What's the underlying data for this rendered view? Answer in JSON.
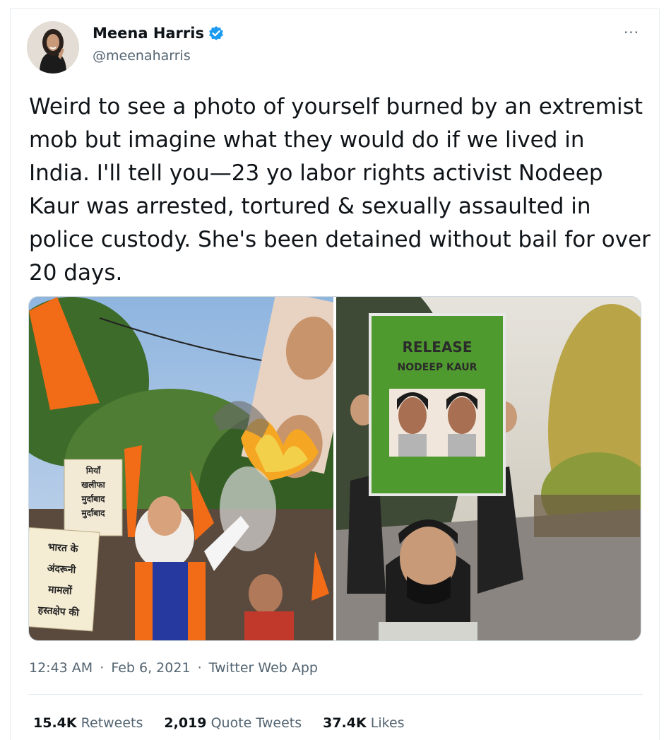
{
  "author": {
    "name": "Meena Harris",
    "handle": "@meenaharris",
    "verified": true,
    "avatar": "avatar-photo",
    "verified_icon": "verified-badge-icon",
    "more_icon": "more-options-icon",
    "more_label": "···"
  },
  "tweet": {
    "text": "Weird to see a photo of yourself burned by an extremist mob but imagine what they would do if we lived in India. I'll tell you—23 yo labor rights activist Nodeep Kaur was arrested, tortured & sexually assaulted in police custody. She's been detained without bail for over 20 days."
  },
  "media": {
    "left_photo": {
      "sign_1": [
        "मियाँ",
        "खलीफा",
        "मुर्दाबाद",
        "मुर्दाबाद"
      ],
      "sign_2": [
        "भारत के",
        "अंदरूनी",
        "मामलों",
        "हस्तक्षेप की"
      ]
    },
    "right_photo": {
      "poster_line_1": "RELEASE",
      "poster_line_2": "NODEEP KAUR"
    }
  },
  "meta": {
    "time": "12:43 AM",
    "date": "Feb 6, 2021",
    "separator": "·",
    "app": "Twitter Web App"
  },
  "stats": {
    "retweets_count": "15.4K",
    "retweets_label": "Retweets",
    "quotes_count": "2,019",
    "quotes_label": "Quote Tweets",
    "likes_count": "37.4K",
    "likes_label": "Likes"
  },
  "colors": {
    "text": "#0f1419",
    "secondary": "#536471",
    "verified": "#1d9bf0",
    "poster_green": "#4f9a2e",
    "saffron": "#f26b16"
  }
}
